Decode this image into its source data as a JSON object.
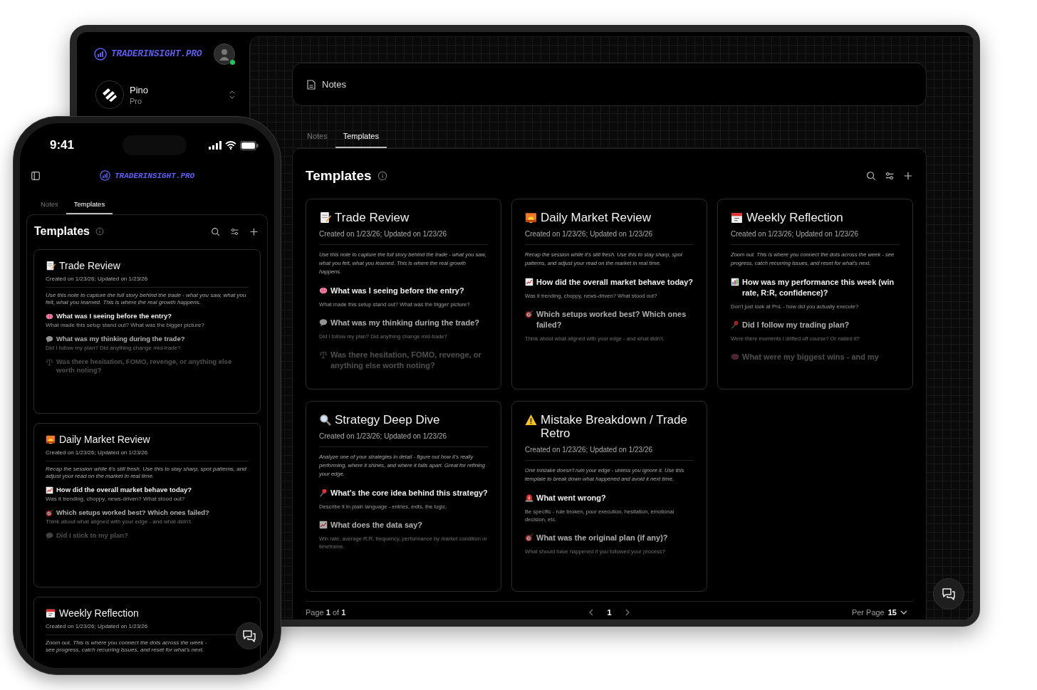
{
  "tablet": {
    "brand": "TRADERINSIGHT.PRO",
    "avatar": {
      "online": true
    },
    "workspace": {
      "name": "Pino",
      "plan": "Pro"
    },
    "header": {
      "title": "Notes"
    },
    "tabs": [
      {
        "label": "Notes",
        "selected": false
      },
      {
        "label": "Templates",
        "selected": true
      }
    ],
    "panel_title": "Templates",
    "cards": [
      {
        "title": "Trade Review",
        "meta": "Created on 1/23/26; Updated on 1/23/26",
        "description": "Use this note to capture the full story behind the trade - what you saw, what you felt, what you learned. This is where the real growth happens.",
        "prompts": [
          {
            "question": "What was I seeing before the entry?",
            "hint": "What made this setup stand out? What was the bigger picture?"
          },
          {
            "question": "What was my thinking during the trade?",
            "hint": "Did I follow my plan? Did anything change mid-trade?"
          },
          {
            "question": "Was there hesitation, FOMO, revenge, or anything else worth noting?"
          }
        ]
      },
      {
        "title": "Daily Market Review",
        "meta": "Created on 1/23/26; Updated on 1/23/26",
        "description": "Recap the session while it's still fresh. Use this to stay sharp, spot patterns, and adjust your read on the market in real time.",
        "prompts": [
          {
            "question": "How did the overall market behave today?",
            "hint": "Was it trending, choppy, news-driven? What stood out?"
          },
          {
            "question": "Which setups worked best? Which ones failed?",
            "hint": "Think about what aligned with your edge - and what didn't."
          }
        ]
      },
      {
        "title": "Weekly Reflection",
        "meta": "Created on 1/23/26; Updated on 1/23/26",
        "description": "Zoom out. This is where you connect the dots across the week - see progress, catch recurring issues, and reset for what's next.",
        "prompts": [
          {
            "question": "How was my performance this week (win rate, R:R, confidence)?",
            "hint": "Don't just look at PnL - how did you actually execute?"
          },
          {
            "question": "Did I follow my trading plan?",
            "hint": "Were there moments I drifted off course? Or nailed it?"
          },
          {
            "question": "What were my biggest wins - and my"
          }
        ]
      },
      {
        "title": "Strategy Deep Dive",
        "meta": "Created on 1/23/26; Updated on 1/23/26",
        "description": "Analyze one of your strategies in detail - figure out how it's really performing, where it shines, and where it falls apart. Great for refining your edge.",
        "prompts": [
          {
            "question": "What's the core idea behind this strategy?",
            "hint": "Describe it in plain language - entries, exits, the logic."
          },
          {
            "question": "What does the data say?",
            "hint": "Win rate, average R:R, frequency, performance by market condition or timeframe."
          }
        ]
      },
      {
        "title": "Mistake Breakdown / Trade Retro",
        "meta": "Created on 1/23/26; Updated on 1/23/26",
        "description": "One mistake doesn't ruin your edge - unless you ignore it. Use this template to break down what happened and avoid it next time.",
        "prompts": [
          {
            "question": "What went wrong?",
            "hint": "Be specific - rule broken, poor execution, hesitation, emotional decision, etc."
          },
          {
            "question": "What was the original plan (if any)?",
            "hint": "What should have happened if you followed your process?"
          }
        ]
      }
    ],
    "pagination": {
      "summary": "Page **1** of **1**",
      "current_page": "1",
      "per_page_label": "Per Page",
      "per_page": "15"
    }
  },
  "phone": {
    "time": "9:41",
    "brand": "TRADERINSIGHT.PRO",
    "tabs": [
      {
        "label": "Notes",
        "selected": false
      },
      {
        "label": "Templates",
        "selected": true
      }
    ],
    "panel_title": "Templates",
    "cards": [
      {
        "title": "Trade Review",
        "meta": "Created on 1/23/26; Updated on 1/23/26",
        "description": "Use this note to capture the full story behind the trade - what you saw, what you felt, what you learned. This is where the real growth happens.",
        "prompts": [
          {
            "question": "What was I seeing before the entry?",
            "hint": "What made this setup stand out? What was the bigger picture?"
          },
          {
            "question": "What was my thinking during the trade?",
            "hint": "Did I follow my plan? Did anything change mid-trade?"
          },
          {
            "question": "Was there hesitation, FOMO, revenge, or anything else worth noting?"
          }
        ]
      },
      {
        "title": "Daily Market Review",
        "meta": "Created on 1/23/26; Updated on 1/23/26",
        "description": "Recap the session while it's still fresh. Use this to stay sharp, spot patterns, and adjust your read on the market in real time.",
        "prompts": [
          {
            "question": "How did the overall market behave today?",
            "hint": "Was it trending, choppy, news-driven? What stood out?"
          },
          {
            "question": "Which setups worked best? Which ones failed?",
            "hint": "Think about what aligned with your edge - and what didn't."
          },
          {
            "question": "Did I stick to my plan?"
          }
        ]
      },
      {
        "title": "Weekly Reflection",
        "meta": "Created on 1/23/26; Updated on 1/23/26",
        "description": "Zoom out. This is where you connect the dots across the week - see progress, catch recurring issues, and reset for what's next."
      }
    ]
  }
}
